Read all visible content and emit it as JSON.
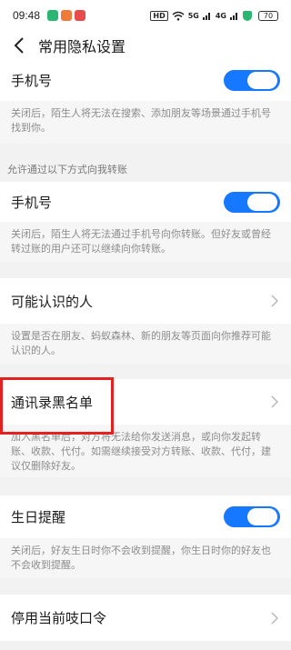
{
  "status_bar": {
    "time": "09:48",
    "network": "HD",
    "signal1": "5G",
    "signal2": "4G",
    "battery": "70"
  },
  "header": {
    "title": "常用隐私设置"
  },
  "sections": {
    "phone_search": {
      "label": "手机号",
      "enabled": true,
      "description": "关闭后，陌生人将无法在搜索、添加朋友等场景通过手机号找到你。"
    },
    "transfer_hint": "允许通过以下方式向我转账",
    "phone_transfer": {
      "label": "手机号",
      "enabled": true,
      "description": "关闭后，陌生人将无法通过手机号向你转账。但好友或曾经转过账的用户还可以继续向你转账。"
    },
    "people_you_may_know": {
      "label": "可能认识的人",
      "description": "设置是否在朋友、蚂蚁森林、新的朋友等页面向你推荐可能认识的人。"
    },
    "contact_blacklist": {
      "label": "通讯录黑名单",
      "description": "加入黑名单后，对方将无法给你发送消息，或向你发起转账、收款、代付。如需继续接受对方转账、收款、代付，建议仅删除好友。"
    },
    "birthday_reminder": {
      "label": "生日提醒",
      "enabled": true,
      "description": "关闭后，好友生日时你不会收到提醒，你生日时你的好友也不会收到提醒。"
    },
    "disable_code": {
      "label": "停用当前吱口令"
    }
  },
  "colors": {
    "accent": "#1677ff",
    "highlight": "#e52020"
  }
}
